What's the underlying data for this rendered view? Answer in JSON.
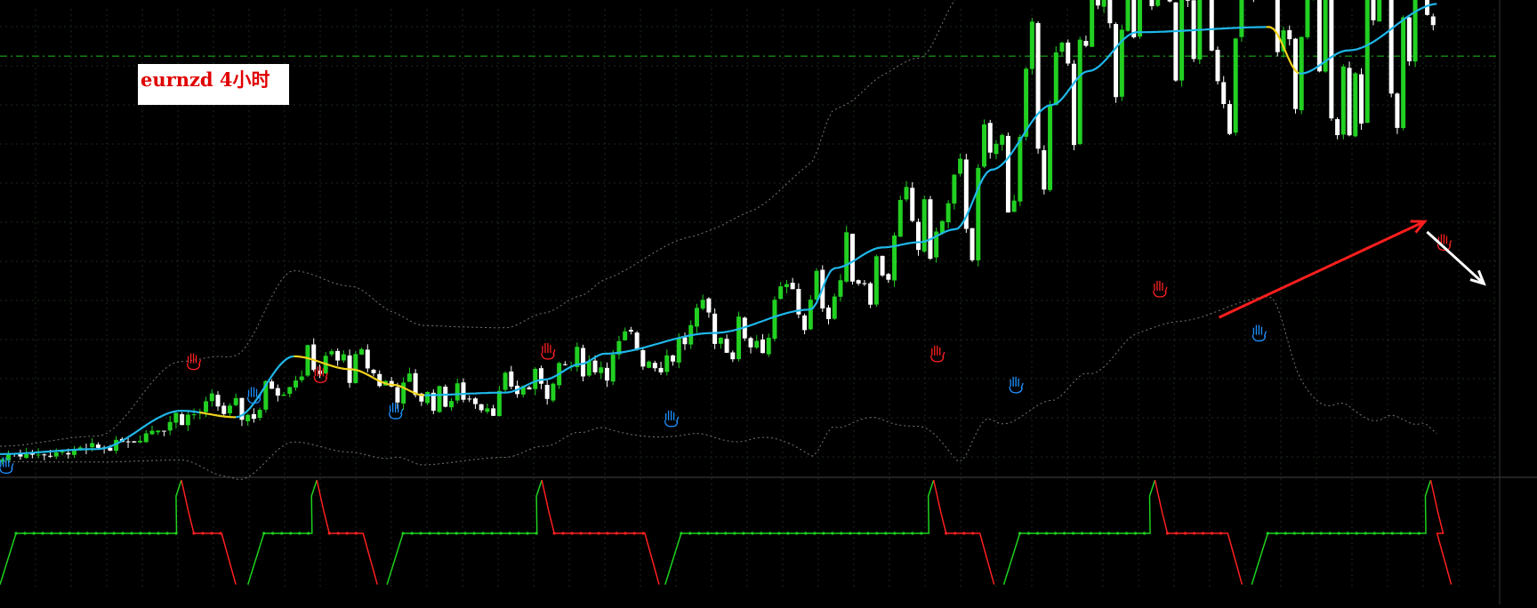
{
  "chart_data": [
    {
      "type": "candlestick",
      "title": "eurnzd 4小时",
      "ylim": [
        1.589,
        1.669
      ],
      "grid": true,
      "colors": {
        "bull": "#22d022",
        "bear": "#ffffff",
        "ma_up": "#1fb7ea",
        "ma_down": "#f1d21b",
        "band": "#777777",
        "price_line": "#22c022",
        "top_arrow": "#ff1e1e",
        "down_arrow": "#ffffff",
        "buy_icon": "#1e90ff",
        "sell_icon": "#ff2020"
      },
      "ma_anchors": [
        [
          0,
          8.3
        ],
        [
          80,
          10.2
        ],
        [
          150,
          25
        ],
        [
          195,
          22.5
        ],
        [
          243,
          46
        ],
        [
          290,
          41
        ],
        [
          325,
          35
        ],
        [
          350,
          31
        ],
        [
          418,
          32
        ],
        [
          450,
          37
        ],
        [
          480,
          43
        ],
        [
          500,
          47
        ],
        [
          590,
          55
        ],
        [
          670,
          64
        ],
        [
          690,
          80
        ],
        [
          730,
          88
        ],
        [
          760,
          90
        ],
        [
          790,
          95
        ],
        [
          820,
          118
        ],
        [
          870,
          143
        ],
        [
          900,
          156
        ],
        [
          940,
          171
        ],
        [
          1050,
          173
        ],
        [
          1075,
          155
        ],
        [
          1115,
          164
        ],
        [
          1190,
          182
        ]
      ],
      "band_anchors": [
        [
          0,
          3
        ],
        [
          80,
          5
        ],
        [
          150,
          19
        ],
        [
          185,
          23
        ],
        [
          243,
          33
        ],
        [
          290,
          32
        ],
        [
          340,
          27
        ],
        [
          418,
          25
        ],
        [
          470,
          26
        ],
        [
          570,
          38
        ],
        [
          620,
          44
        ],
        [
          700,
          62
        ],
        [
          760,
          71
        ],
        [
          800,
          92
        ],
        [
          870,
          114
        ],
        [
          920,
          118
        ],
        [
          975,
          112
        ],
        [
          1050,
          104
        ],
        [
          1105,
          135
        ],
        [
          1145,
          148
        ],
        [
          1175,
          160
        ],
        [
          1190,
          166
        ]
      ],
      "bull_segments": [
        [
          0,
          5
        ],
        [
          150,
          165
        ],
        [
          195,
          210
        ],
        [
          355,
          380
        ],
        [
          590,
          700
        ],
        [
          745,
          770
        ],
        [
          810,
          870
        ],
        [
          940,
          990
        ],
        [
          1165,
          1190
        ]
      ],
      "signals": {
        "sell": [
          [
            160,
            44
          ],
          [
            265,
            39
          ],
          [
            453,
            48
          ],
          [
            775,
            47
          ],
          [
            959,
            72
          ],
          [
            1194,
            90
          ]
        ],
        "buy": [
          [
            5,
            4
          ],
          [
            210,
            31
          ],
          [
            327,
            25
          ],
          [
            555,
            22
          ],
          [
            840,
            35
          ],
          [
            1041,
            55
          ]
        ]
      },
      "current_price": 1.6609,
      "arrows": {
        "up": {
          "from": [
            1008,
            61
          ],
          "to": [
            1178,
            98
          ]
        },
        "down": {
          "from": [
            1180,
            94
          ],
          "to": [
            1227,
            74
          ]
        }
      },
      "candle_count": 240,
      "seed": 7
    },
    {
      "type": "line",
      "series_name": "oscillator",
      "ylim": [
        0,
        100
      ],
      "cycles": [
        {
          "start": 0,
          "peak": 150,
          "neutral_end": 146
        },
        {
          "start": 205,
          "peak": 262,
          "neutral_end": 258
        },
        {
          "start": 320,
          "peak": 448,
          "neutral_end": 444
        },
        {
          "start": 550,
          "peak": 772,
          "neutral_end": 768
        },
        {
          "start": 830,
          "peak": 955,
          "neutral_end": 951
        },
        {
          "start": 1035,
          "peak": 1183,
          "neutral_end": 1179
        }
      ],
      "red_ends": [
        195,
        312,
        545,
        822,
        1027,
        1200
      ],
      "neutral_level": 50,
      "colors": {
        "up": "#1ed21e",
        "down": "#ff2020"
      }
    }
  ]
}
